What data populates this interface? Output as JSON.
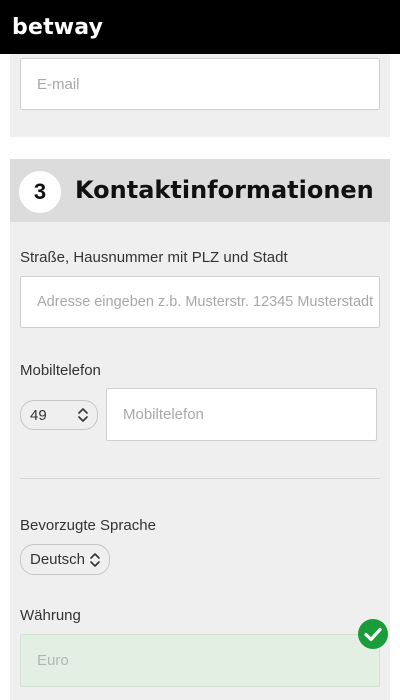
{
  "brand": {
    "name": "betway"
  },
  "registration": {
    "email": {
      "placeholder": "E-mail"
    },
    "section": {
      "step": "3",
      "title": "Kontaktinformationen"
    },
    "address": {
      "label": "Straße, Hausnummer mit PLZ und Stadt",
      "placeholder": "Adresse eingeben z.b. Musterstr. 12345 Musterstadt"
    },
    "mobile": {
      "label": "Mobiltelefon",
      "country_code": "49",
      "placeholder": "Mobiltelefon"
    },
    "language": {
      "label": "Bevorzugte Sprache",
      "selected": "Deutsch"
    },
    "currency": {
      "label": "Währung",
      "value": "Euro",
      "status": "valid"
    }
  },
  "colors": {
    "topbar": "#000000",
    "card": "#efefef",
    "header": "#dcdcdc",
    "success": "#1b9c3a",
    "valid_field": "#e3efe3"
  },
  "icons": {
    "select": "chevron-up-down-icon",
    "valid": "check-circle-icon"
  }
}
